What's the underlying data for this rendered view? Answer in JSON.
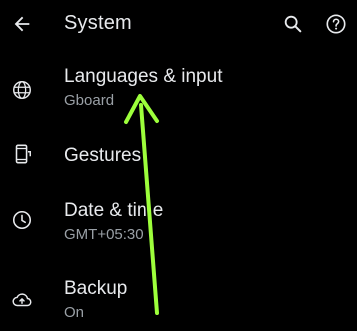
{
  "header": {
    "title": "System",
    "icons": {
      "back": "back-arrow-icon",
      "search": "search-icon",
      "help": "help-icon"
    }
  },
  "items": [
    {
      "title": "Languages & input",
      "subtitle": "Gboard",
      "icon": "globe-icon"
    },
    {
      "title": "Gestures",
      "subtitle": "",
      "icon": "phone-gesture-icon"
    },
    {
      "title": "Date & time",
      "subtitle": "GMT+05:30",
      "icon": "clock-icon"
    },
    {
      "title": "Backup",
      "subtitle": "On",
      "icon": "cloud-upload-icon"
    }
  ],
  "colors": {
    "background": "#000000",
    "primary_text": "#e8eaed",
    "secondary_text": "#9aa0a6",
    "annotation_arrow": "#9dff3b"
  }
}
